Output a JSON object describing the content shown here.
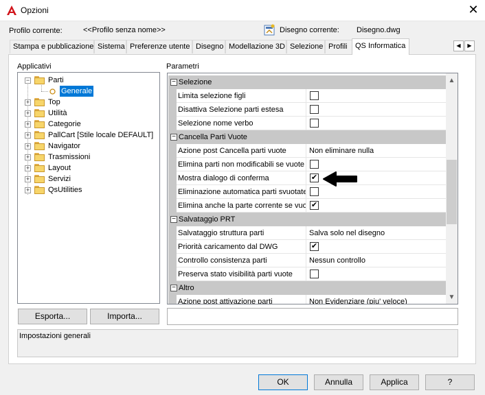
{
  "window": {
    "title": "Opzioni",
    "close_symbol": "✕",
    "icon": "autocad-a-icon"
  },
  "profile": {
    "label": "Profilo corrente:",
    "value": "<<Profilo senza nome>>",
    "drawing_label": "Disegno corrente:",
    "drawing_value": "Disegno.dwg"
  },
  "tabs": [
    {
      "label": "Stampa e pubblicazione"
    },
    {
      "label": "Sistema"
    },
    {
      "label": "Preferenze utente"
    },
    {
      "label": "Disegno"
    },
    {
      "label": "Modellazione 3D"
    },
    {
      "label": "Selezione"
    },
    {
      "label": "Profili"
    },
    {
      "label": "QS Informatica",
      "active": true
    }
  ],
  "tab_scroll": {
    "left": "◀",
    "right": "▶"
  },
  "applicativi": {
    "label": "Applicativi",
    "tree": [
      {
        "label": "Parti",
        "expanded": true,
        "exp": "−"
      },
      {
        "label": "Generale",
        "selected": true
      },
      {
        "label": "Top",
        "exp": "+"
      },
      {
        "label": "Utilità",
        "exp": "+"
      },
      {
        "label": "Categorie",
        "exp": "+"
      },
      {
        "label": "PallCart [Stile locale DEFAULT]",
        "exp": "+"
      },
      {
        "label": "Navigator",
        "exp": "+"
      },
      {
        "label": "Trasmissioni",
        "exp": "+"
      },
      {
        "label": "Layout",
        "exp": "+"
      },
      {
        "label": "Servizi",
        "exp": "+"
      },
      {
        "label": "QsUtilities",
        "exp": "+"
      }
    ]
  },
  "parametri": {
    "label": "Parametri",
    "sections": [
      {
        "title": "Selezione",
        "mark": "−"
      },
      {
        "title": "Cancella Parti Vuote",
        "mark": "−"
      },
      {
        "title": "Salvataggio PRT",
        "mark": "−"
      },
      {
        "title": "Altro",
        "mark": "−"
      }
    ],
    "rows": [
      {
        "name": "Limita selezione figli",
        "checked": false
      },
      {
        "name": "Disattiva Selezione parti estesa",
        "checked": false
      },
      {
        "name": "Selezione nome verbo",
        "checked": false
      },
      {
        "name": "Azione post Cancella parti vuote",
        "value": "Non eliminare nulla"
      },
      {
        "name": "Elimina parti non modificabili se vuote",
        "checked": false
      },
      {
        "name": "Mostra dialogo di conferma",
        "checked": true
      },
      {
        "name": "Eliminazione automatica parti svuotate",
        "checked": false
      },
      {
        "name": "Elimina anche la parte corrente se vuota",
        "checked": true
      },
      {
        "name": "Salvataggio struttura parti",
        "value": "Salva solo nel disegno"
      },
      {
        "name": "Priorità caricamento dal DWG",
        "checked": true
      },
      {
        "name": "Controllo consistenza parti",
        "value": "Nessun controllo"
      },
      {
        "name": "Preserva stato visibilità parti vuote",
        "checked": false
      },
      {
        "name": "Azione post attivazione parti",
        "value": "Non Evidenziare (piu' veloce)"
      }
    ],
    "check_symbol": "✔",
    "scroll_up": "▲",
    "scroll_down": "▼"
  },
  "actions": {
    "export": "Esporta...",
    "import": "Importa..."
  },
  "description": "Impostazioni generali",
  "footer": {
    "ok": "OK",
    "cancel": "Annulla",
    "apply": "Applica",
    "help": "?"
  }
}
